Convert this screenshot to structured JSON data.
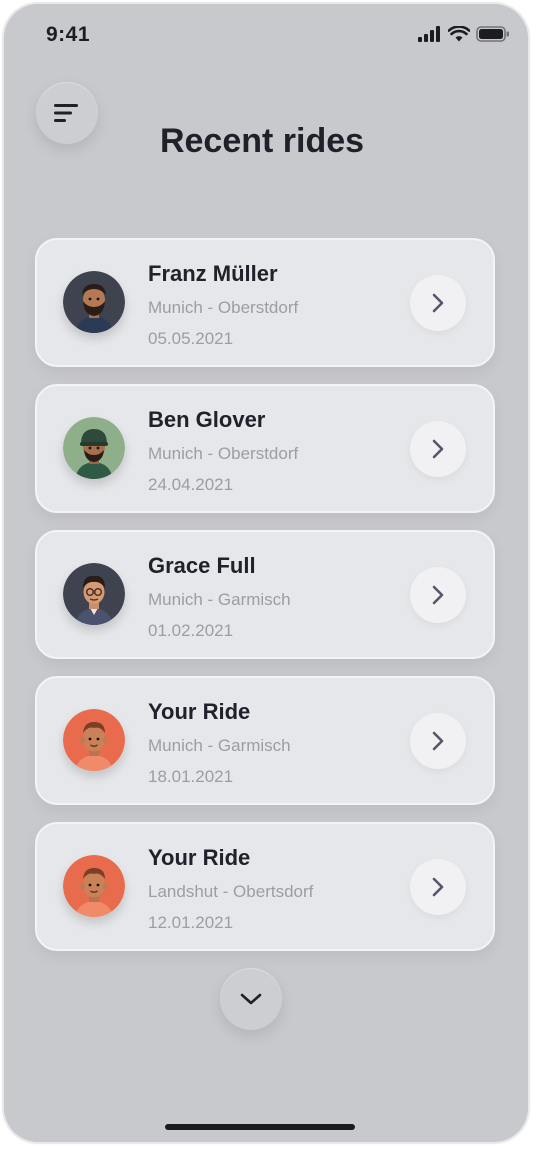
{
  "status_bar": {
    "time": "9:41",
    "icons": [
      "signal-icon",
      "wifi-icon",
      "battery-icon"
    ]
  },
  "header": {
    "menu_icon": "filter-lines-icon",
    "title": "Recent rides"
  },
  "rides": [
    {
      "name": "Franz Müller",
      "route": "Munich - Oberstdorf",
      "date": "05.05.2021",
      "avatar": "avatar-bearded-man-dark"
    },
    {
      "name": "Ben Glover",
      "route": "Munich - Oberstdorf",
      "date": "24.04.2021",
      "avatar": "avatar-man-green-cap"
    },
    {
      "name": "Grace Full",
      "route": "Munich - Garmisch",
      "date": "01.02.2021",
      "avatar": "avatar-man-glasses-dark"
    },
    {
      "name": "Your Ride",
      "route": "Munich - Garmisch",
      "date": "18.01.2021",
      "avatar": "avatar-boy-orange"
    },
    {
      "name": "Your Ride",
      "route": "Landshut - Obertsdorf",
      "date": "12.01.2021",
      "avatar": "avatar-boy-orange"
    }
  ],
  "footer": {
    "more_icon": "chevron-down-icon"
  },
  "colors": {
    "background": "#c8c9cd",
    "card": "#e6e7ea",
    "title": "#1f2029",
    "muted_text": "#9c9da5",
    "arrow_icon": "#55566a",
    "avatar_dark": "#3f424f",
    "avatar_green": "#8fae8a",
    "avatar_orange": "#e86b4d"
  }
}
